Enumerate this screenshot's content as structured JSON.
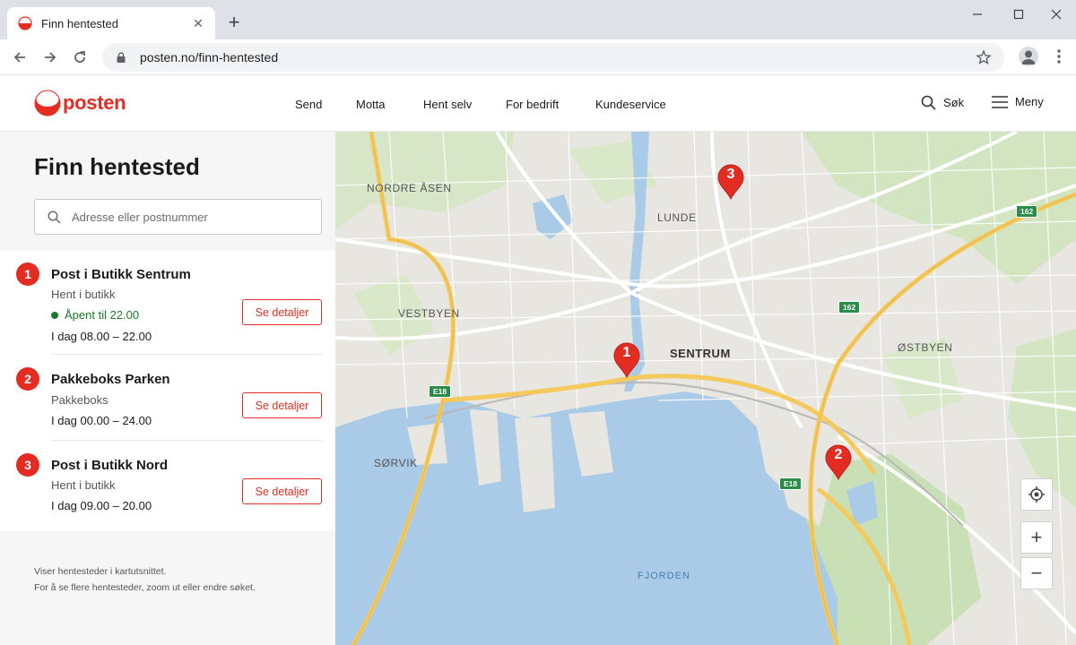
{
  "browser": {
    "tab_title": "Finn hentested",
    "tab_close": "✕",
    "new_tab": "+",
    "url_path": "posten.no/finn-hentested"
  },
  "header": {
    "logo_text": "posten",
    "nav": [
      "Send",
      "Motta",
      "Hent selv",
      "For bedrift",
      "Kundeservice"
    ],
    "search_label": "Søk",
    "menu_label": "Meny"
  },
  "sidebar": {
    "title": "Finn hentested",
    "search_placeholder": "Adresse eller postnummer",
    "results": [
      {
        "number": "1",
        "name": "Post i Butikk Sentrum",
        "type": "Hent i butikk",
        "status": "Åpent til 22.00",
        "hours": "I dag  08.00 – 22.00",
        "button": "Se detaljer"
      },
      {
        "number": "2",
        "name": "Pakkeboks Parken",
        "type": "Pakkeboks",
        "hours": "I dag  00.00 – 24.00",
        "button": "Se detaljer"
      },
      {
        "number": "3",
        "name": "Post i Butikk Nord",
        "type": "Hent i butikk",
        "hours": "I dag  09.00 – 20.00",
        "button": "Se detaljer"
      }
    ],
    "footer_line1": "Viser hentesteder i kartutsnittet.",
    "footer_line2": "For å se flere hentesteder, zoom ut eller endre søket."
  },
  "map": {
    "labels": {
      "nordre_asen": "NORDRE ÅSEN",
      "lunde": "LUNDE",
      "vestbyen": "VESTBYEN",
      "sentrum": "SENTRUM",
      "ostbyen": "ØSTBYEN",
      "sorvik": "SØRVIK",
      "fjorden": "FJORDEN"
    },
    "shields": {
      "e18_west": "E18",
      "e18_east": "E18",
      "r162_north": "162",
      "r162_mid": "162"
    },
    "pins": [
      "1",
      "2",
      "3"
    ],
    "controls": {
      "zoom_in": "+",
      "zoom_out": "−"
    },
    "colors": {
      "pin": "#e32d22",
      "water": "#a9cbe8",
      "park": "#cfe3bf",
      "motorway": "#f4c95d"
    }
  }
}
